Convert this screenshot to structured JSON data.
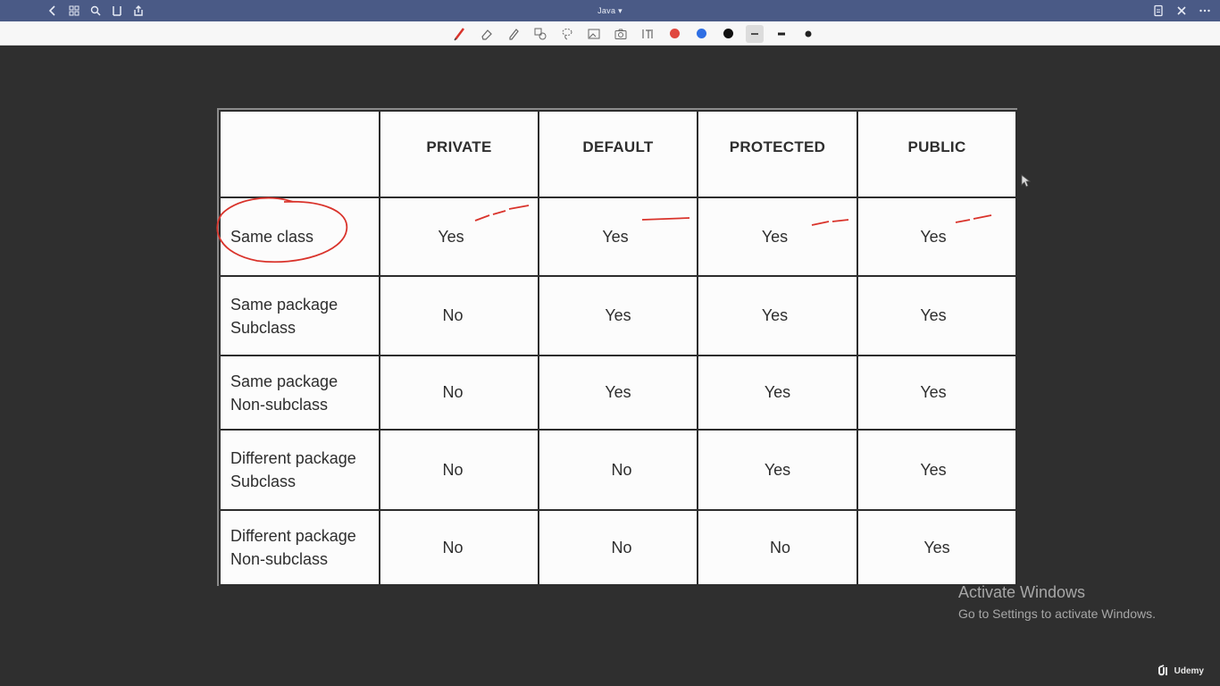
{
  "titlebar": {
    "doc_title": "Java ▾",
    "left_icons": [
      "back-icon",
      "grid-icon",
      "search-icon",
      "bookmark-icon",
      "share-icon"
    ],
    "right_icons": [
      "page-icon",
      "close-icon",
      "more-icon"
    ]
  },
  "toolbar": {
    "tools": [
      "pen-icon",
      "eraser-icon",
      "highlighter-icon",
      "shapes-icon",
      "lasso-icon",
      "image-icon",
      "camera-icon",
      "text-icon"
    ],
    "colors": [
      "#e0483f",
      "#2f6fe4",
      "#111111"
    ],
    "sizes": [
      "thin",
      "medium",
      "thick"
    ]
  },
  "table": {
    "headers": [
      "",
      "PRIVATE",
      "DEFAULT",
      "PROTECTED",
      "PUBLIC"
    ],
    "rows": [
      {
        "line1": "Same class",
        "line2": "",
        "values": [
          "Yes",
          "Yes",
          "Yes",
          "Yes"
        ]
      },
      {
        "line1": "Same package",
        "line2": "Subclass",
        "values": [
          "No",
          "Yes",
          "Yes",
          "Yes"
        ]
      },
      {
        "line1": "Same package",
        "line2": "Non-subclass",
        "values": [
          "No",
          "Yes",
          "Yes",
          "Yes"
        ]
      },
      {
        "line1": "Different package",
        "line2": "Subclass",
        "values": [
          "No",
          "No",
          "Yes",
          "Yes"
        ]
      },
      {
        "line1": "Different package",
        "line2": "Non-subclass",
        "values": [
          "No",
          "No",
          "No",
          "Yes"
        ]
      }
    ]
  },
  "annotation_color": "#d9332b",
  "watermark": {
    "title": "Activate Windows",
    "subtitle": "Go to Settings to activate Windows."
  },
  "brand": "Udemy"
}
